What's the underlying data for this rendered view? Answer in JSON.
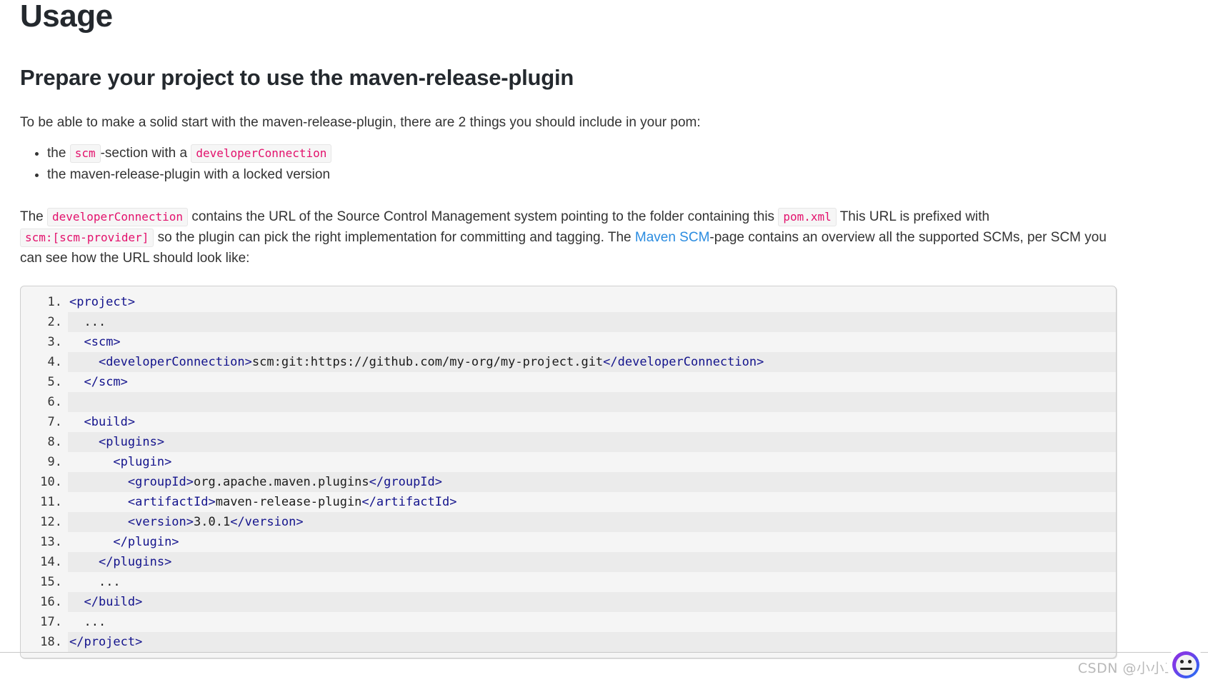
{
  "page": {
    "title": "Usage",
    "section_title": "Prepare your project to use the maven-release-plugin"
  },
  "intro": {
    "text": "To be able to make a solid start with the maven-release-plugin, there are 2 things you should include in your pom:"
  },
  "bullets": [
    {
      "prefix": "the ",
      "code1": "scm",
      "middle": "-section with a ",
      "code2": "developerConnection",
      "suffix": ""
    },
    {
      "text": "the maven-release-plugin with a locked version"
    }
  ],
  "paragraph": {
    "p1": "The ",
    "code_devconn": "developerConnection",
    "p2": " contains the URL of the Source Control Management system pointing to the folder containing this ",
    "code_pom": "pom.xml",
    "p3": " This URL is prefixed with ",
    "code_scmprovider": "scm:[scm-provider]",
    "p4": " so the plugin can pick the right implementation for committing and tagging. The ",
    "link_label": "Maven SCM",
    "p5": "-page contains an overview all the supported SCMs, per SCM you can see how the URL should look like:"
  },
  "code_block": {
    "language": "xml",
    "lines": [
      {
        "n": "1.",
        "indent": 0,
        "parts": [
          {
            "t": "tag",
            "v": "<project>"
          }
        ]
      },
      {
        "n": "2.",
        "indent": 1,
        "parts": [
          {
            "t": "txt",
            "v": "..."
          }
        ]
      },
      {
        "n": "3.",
        "indent": 1,
        "parts": [
          {
            "t": "tag",
            "v": "<scm>"
          }
        ]
      },
      {
        "n": "4.",
        "indent": 2,
        "parts": [
          {
            "t": "tag",
            "v": "<developerConnection>"
          },
          {
            "t": "txt",
            "v": "scm:git:https://github.com/my-org/my-project.git"
          },
          {
            "t": "tag",
            "v": "</developerConnection>"
          }
        ]
      },
      {
        "n": "5.",
        "indent": 1,
        "parts": [
          {
            "t": "tag",
            "v": "</scm>"
          }
        ]
      },
      {
        "n": "6.",
        "indent": 0,
        "parts": [
          {
            "t": "txt",
            "v": ""
          }
        ]
      },
      {
        "n": "7.",
        "indent": 1,
        "parts": [
          {
            "t": "tag",
            "v": "<build>"
          }
        ]
      },
      {
        "n": "8.",
        "indent": 2,
        "parts": [
          {
            "t": "tag",
            "v": "<plugins>"
          }
        ]
      },
      {
        "n": "9.",
        "indent": 3,
        "parts": [
          {
            "t": "tag",
            "v": "<plugin>"
          }
        ]
      },
      {
        "n": "10.",
        "indent": 4,
        "parts": [
          {
            "t": "tag",
            "v": "<groupId>"
          },
          {
            "t": "txt",
            "v": "org.apache.maven.plugins"
          },
          {
            "t": "tag",
            "v": "</groupId>"
          }
        ]
      },
      {
        "n": "11.",
        "indent": 4,
        "parts": [
          {
            "t": "tag",
            "v": "<artifactId>"
          },
          {
            "t": "txt",
            "v": "maven-release-plugin"
          },
          {
            "t": "tag",
            "v": "</artifactId>"
          }
        ]
      },
      {
        "n": "12.",
        "indent": 4,
        "parts": [
          {
            "t": "tag",
            "v": "<version>"
          },
          {
            "t": "txt",
            "v": "3.0.1"
          },
          {
            "t": "tag",
            "v": "</version>"
          }
        ]
      },
      {
        "n": "13.",
        "indent": 3,
        "parts": [
          {
            "t": "tag",
            "v": "</plugin>"
          }
        ]
      },
      {
        "n": "14.",
        "indent": 2,
        "parts": [
          {
            "t": "tag",
            "v": "</plugins>"
          }
        ]
      },
      {
        "n": "15.",
        "indent": 2,
        "parts": [
          {
            "t": "txt",
            "v": "..."
          }
        ]
      },
      {
        "n": "16.",
        "indent": 1,
        "parts": [
          {
            "t": "tag",
            "v": "</build>"
          }
        ]
      },
      {
        "n": "17.",
        "indent": 1,
        "parts": [
          {
            "t": "txt",
            "v": "..."
          }
        ]
      },
      {
        "n": "18.",
        "indent": 0,
        "parts": [
          {
            "t": "tag",
            "v": "</project>"
          }
        ]
      }
    ]
  },
  "watermark": {
    "text": "CSDN @小小工匠",
    "avatar_icon": "user-avatar-icon"
  },
  "colors": {
    "heading": "#24292e",
    "body": "#333333",
    "inline_code": "#e3116c",
    "link": "#2b8ce0",
    "xml_tag": "#13138c",
    "code_bg": "#f5f5f5",
    "code_stripe": "#ebebeb",
    "watermark": "#b9b9b9"
  }
}
